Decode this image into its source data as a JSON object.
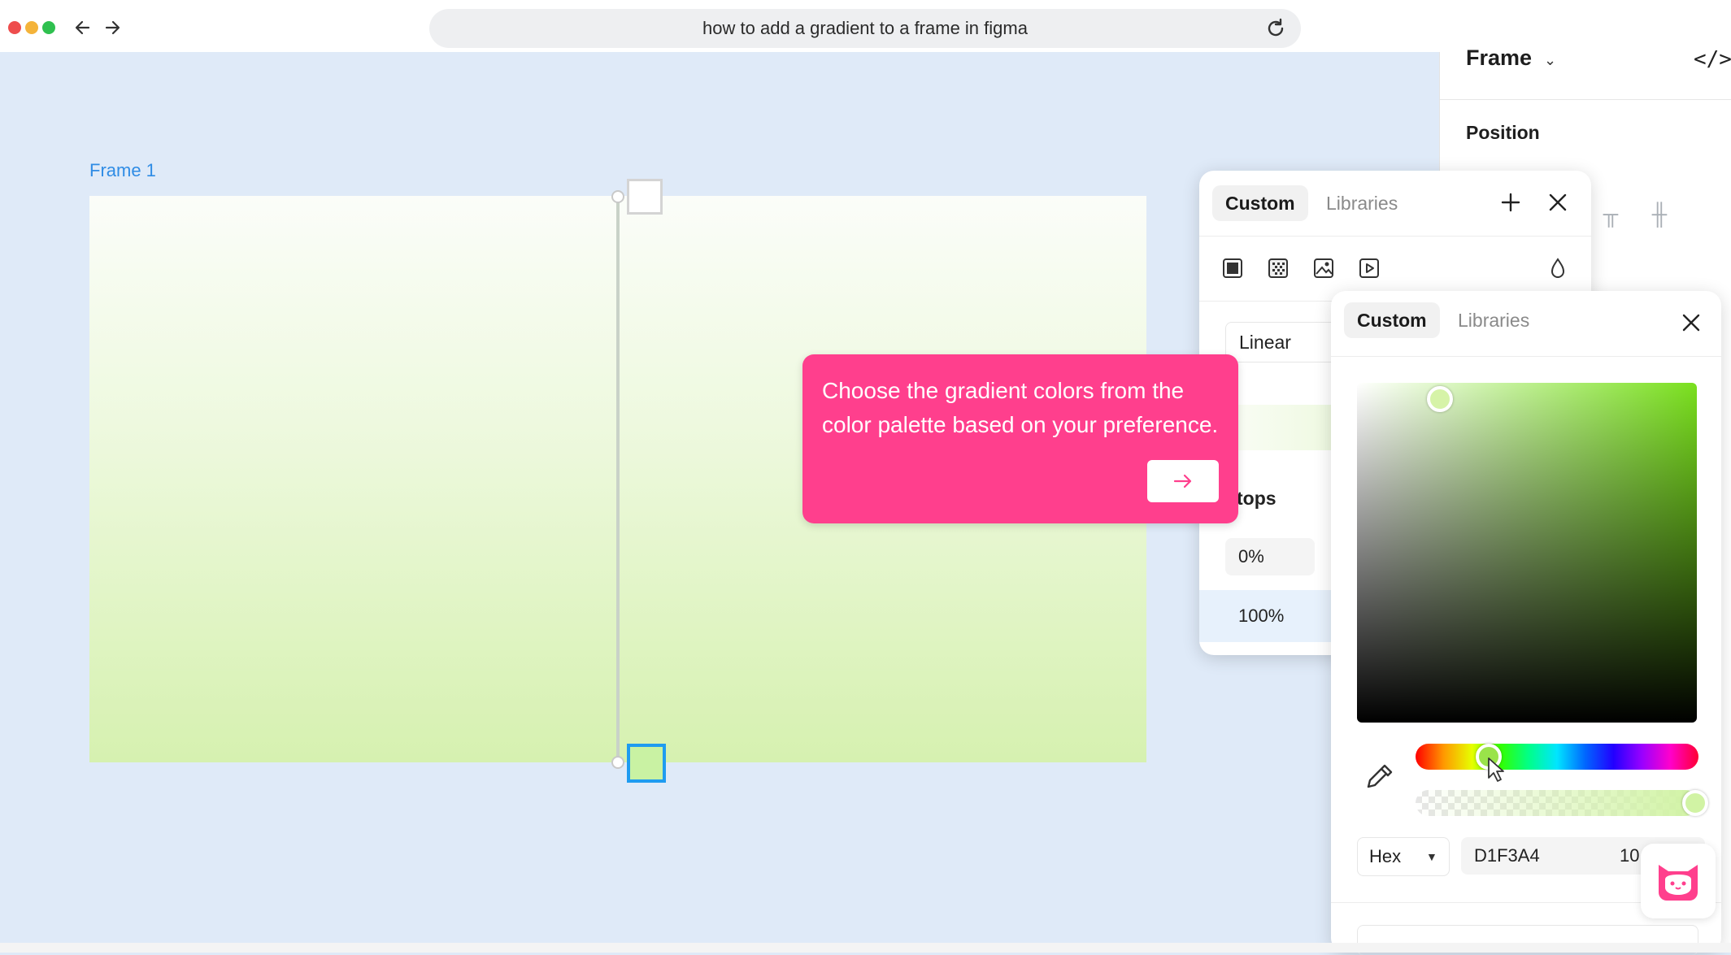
{
  "browser": {
    "url_text": "how to add a gradient to a frame in figma",
    "traffic_colors": [
      "#ee4d4d",
      "#f4b33a",
      "#2fc04f"
    ]
  },
  "canvas": {
    "frame_label": "Frame 1",
    "gradient_colors": [
      "#fbfdf9",
      "#d6f1b0"
    ]
  },
  "properties": {
    "title": "Frame",
    "position_label": "Position",
    "code_icon": "</>"
  },
  "fill_panel": {
    "tabs": [
      "Custom",
      "Libraries"
    ],
    "type_label": "Linear",
    "stops_label": "tops",
    "stop_values": [
      "0%",
      "100%"
    ]
  },
  "color_picker": {
    "tabs": [
      "Custom",
      "Libraries"
    ],
    "mode": "Hex",
    "hex_value": "D1F3A4",
    "opacity_value": "10",
    "selected_color": "#d1f3a4"
  },
  "tooltip": {
    "text": "Choose the gradient colors from the color palette based on your preference.",
    "bg_color": "#ff3f8d"
  }
}
